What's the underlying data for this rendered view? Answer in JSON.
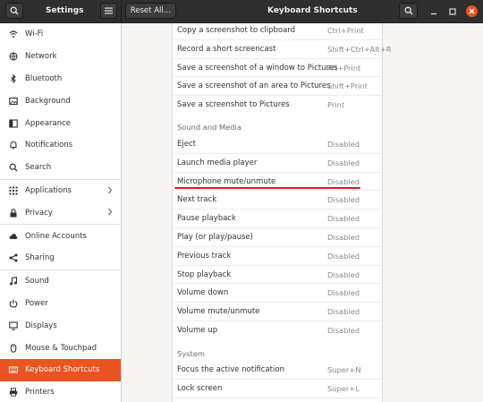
{
  "header": {
    "app_title": "Settings",
    "reset_label": "Reset All…",
    "window_title": "Keyboard Shortcuts"
  },
  "sidebar": {
    "items": [
      {
        "label": "Wi-Fi",
        "icon": "wifi-icon"
      },
      {
        "label": "Network",
        "icon": "network-icon"
      },
      {
        "label": "Bluetooth",
        "icon": "bluetooth-icon"
      },
      {
        "label": "Background",
        "icon": "background-icon"
      },
      {
        "label": "Appearance",
        "icon": "appearance-icon"
      },
      {
        "label": "Notifications",
        "icon": "bell-icon"
      },
      {
        "label": "Search",
        "icon": "search-icon"
      },
      {
        "label": "Applications",
        "icon": "applications-icon"
      },
      {
        "label": "Privacy",
        "icon": "privacy-icon"
      },
      {
        "label": "Online Accounts",
        "icon": "cloud-icon"
      },
      {
        "label": "Sharing",
        "icon": "share-icon"
      },
      {
        "label": "Sound",
        "icon": "music-note-icon"
      },
      {
        "label": "Power",
        "icon": "power-icon"
      },
      {
        "label": "Displays",
        "icon": "display-icon"
      },
      {
        "label": "Mouse & Touchpad",
        "icon": "mouse-icon"
      },
      {
        "label": "Keyboard Shortcuts",
        "icon": "keyboard-icon"
      },
      {
        "label": "Printers",
        "icon": "printer-icon"
      }
    ]
  },
  "shortcuts": {
    "screenshots": [
      {
        "name": "Copy a screenshot to clipboard",
        "accel": "Ctrl+Print"
      },
      {
        "name": "Record a short screencast",
        "accel": "Shift+Ctrl+Alt+R"
      },
      {
        "name": "Save a screenshot of a window to Pictures",
        "accel": "Alt+Print"
      },
      {
        "name": "Save a screenshot of an area to Pictures",
        "accel": "Shift+Print"
      },
      {
        "name": "Save a screenshot to Pictures",
        "accel": "Print"
      }
    ],
    "sound_media_title": "Sound and Media",
    "sound_media": [
      {
        "name": "Eject",
        "accel": "Disabled"
      },
      {
        "name": "Launch media player",
        "accel": "Disabled"
      },
      {
        "name": "Microphone mute/unmute",
        "accel": "Disabled"
      },
      {
        "name": "Next track",
        "accel": "Disabled"
      },
      {
        "name": "Pause playback",
        "accel": "Disabled"
      },
      {
        "name": "Play (or play/pause)",
        "accel": "Disabled"
      },
      {
        "name": "Previous track",
        "accel": "Disabled"
      },
      {
        "name": "Stop playback",
        "accel": "Disabled"
      },
      {
        "name": "Volume down",
        "accel": "Disabled"
      },
      {
        "name": "Volume mute/unmute",
        "accel": "Disabled"
      },
      {
        "name": "Volume up",
        "accel": "Disabled"
      }
    ],
    "system_title": "System",
    "system": [
      {
        "name": "Focus the active notification",
        "accel": "Super+N"
      },
      {
        "name": "Lock screen",
        "accel": "Super+L"
      }
    ]
  },
  "colors": {
    "accent": "#e95420",
    "highlight_underline": "#d81b2b",
    "header_bg": "#2f2f2f"
  }
}
